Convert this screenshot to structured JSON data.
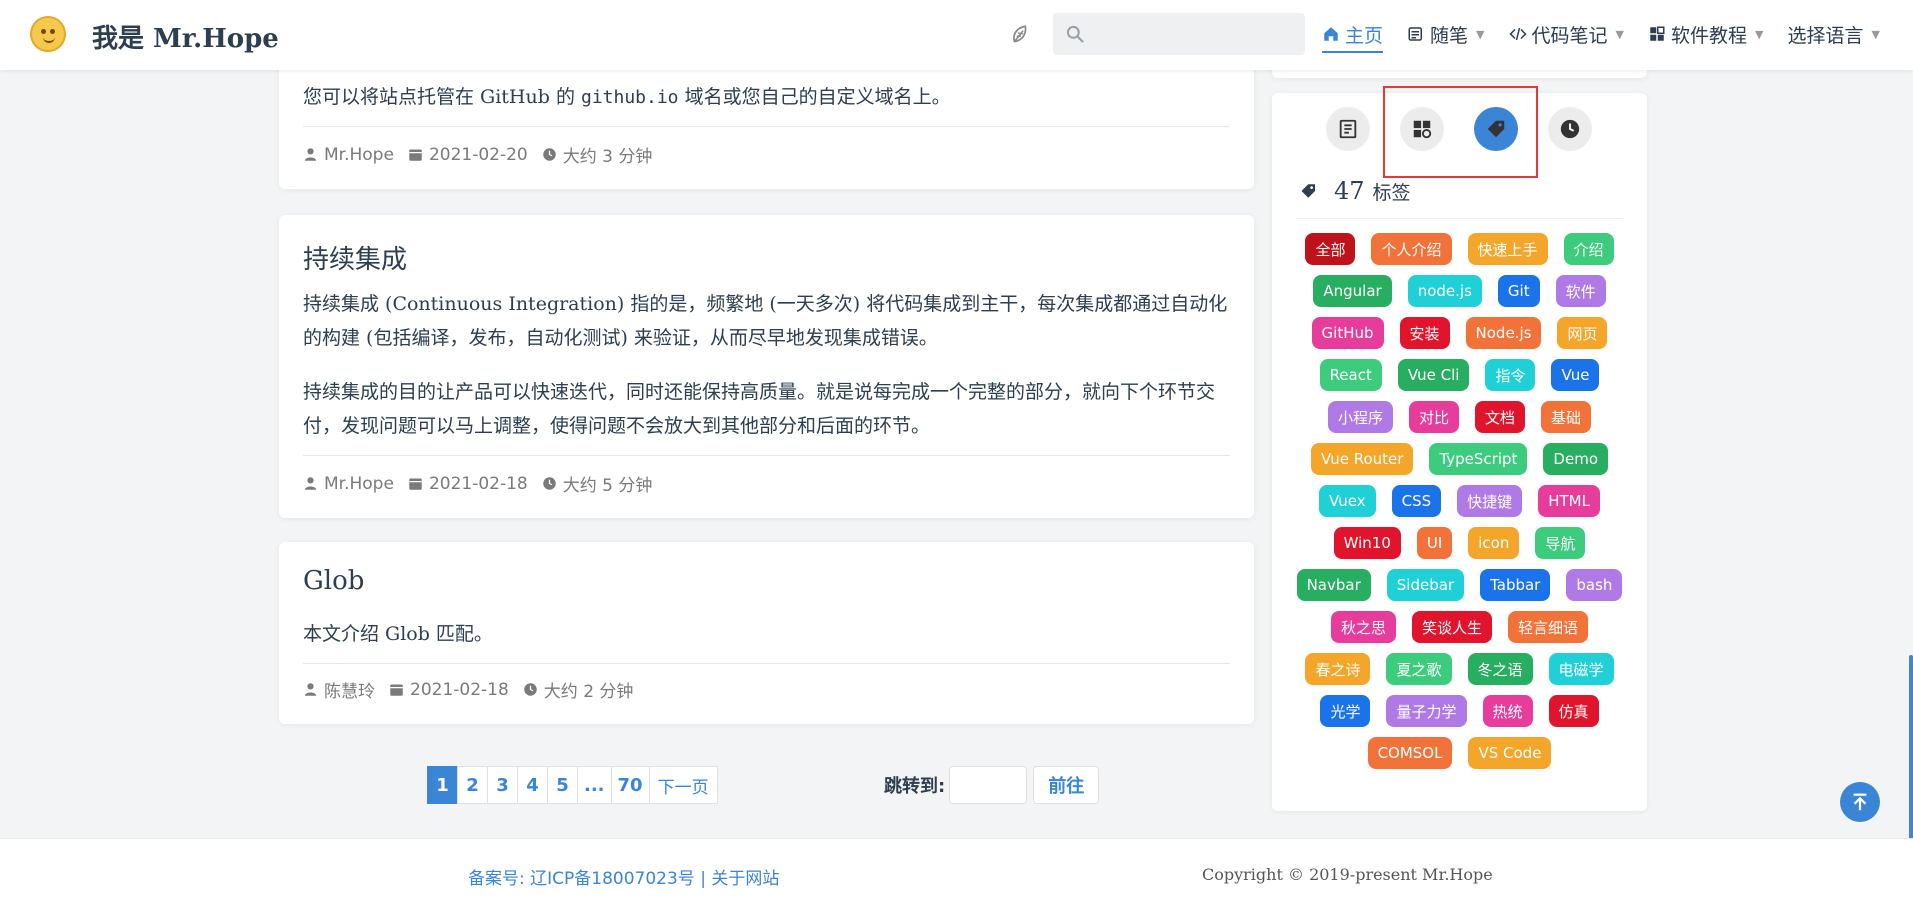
{
  "navbar": {
    "site_title": "我是 Mr.Hope",
    "search_placeholder": "",
    "items": [
      {
        "label": "主页",
        "icon": "home-icon",
        "active": true,
        "dropdown": false
      },
      {
        "label": "随笔",
        "icon": "notes-icon",
        "active": false,
        "dropdown": true
      },
      {
        "label": "代码笔记",
        "icon": "code-icon",
        "active": false,
        "dropdown": true
      },
      {
        "label": "软件教程",
        "icon": "app-icon",
        "active": false,
        "dropdown": true
      },
      {
        "label": "选择语言",
        "icon": "",
        "active": false,
        "dropdown": true
      }
    ]
  },
  "articles": [
    {
      "paragraph_pre": "您可以将站点托管在 GitHub 的 ",
      "paragraph_code": "github.io",
      "paragraph_post": " 域名或您自己的自定义域名上。",
      "author": "Mr.Hope",
      "date": "2021-02-20",
      "reading_time": "大约 3 分钟"
    },
    {
      "title": "持续集成",
      "paragraphs": [
        "持续集成 (Continuous Integration) 指的是，频繁地 (一天多次) 将代码集成到主干，每次集成都通过自动化的构建 (包括编译，发布，自动化测试) 来验证，从而尽早地发现集成错误。",
        "持续集成的目的让产品可以快速迭代，同时还能保持高质量。就是说每完成一个完整的部分，就向下个环节交付，发现问题可以马上调整，使得问题不会放大到其他部分和后面的环节。"
      ],
      "author": "Mr.Hope",
      "date": "2021-02-18",
      "reading_time": "大约 5 分钟"
    },
    {
      "title": "Glob",
      "paragraphs": [
        "本文介绍 Glob 匹配。"
      ],
      "author": "陈慧玲",
      "date": "2021-02-18",
      "reading_time": "大约 2 分钟"
    }
  ],
  "pagination": {
    "pages": [
      "1",
      "2",
      "3",
      "4",
      "5",
      "...",
      "70"
    ],
    "current": "1",
    "next_label": "下一页",
    "jump_label": "跳转到:",
    "jump_button": "前往"
  },
  "sidebar": {
    "tab_icons": [
      "article-icon",
      "category-icon",
      "tag-icon",
      "timeline-icon"
    ],
    "active_tab": "tag-icon",
    "tag_count": "47",
    "tag_label": "标签",
    "tags": [
      [
        {
          "label": "全部",
          "color": "#c0121b"
        },
        {
          "label": "个人介绍",
          "color": "#f2733a"
        },
        {
          "label": "快速上手",
          "color": "#f4a62a"
        },
        {
          "label": "介绍",
          "color": "#3dcc7e"
        }
      ],
      [
        {
          "label": "Angular",
          "color": "#27ae60"
        },
        {
          "label": "node.js",
          "color": "#1fd1d6"
        },
        {
          "label": "Git",
          "color": "#1a73e8"
        },
        {
          "label": "软件",
          "color": "#b07ae6"
        }
      ],
      [
        {
          "label": "GitHub",
          "color": "#e63c9c"
        },
        {
          "label": "安装",
          "color": "#e0152d"
        },
        {
          "label": "Node.js",
          "color": "#f2733a"
        },
        {
          "label": "网页",
          "color": "#f4a62a"
        }
      ],
      [
        {
          "label": "React",
          "color": "#3dcc7e"
        },
        {
          "label": "Vue Cli",
          "color": "#27ae60"
        },
        {
          "label": "指令",
          "color": "#1fd1d6"
        },
        {
          "label": "Vue",
          "color": "#1a73e8"
        }
      ],
      [
        {
          "label": "小程序",
          "color": "#b07ae6"
        },
        {
          "label": "对比",
          "color": "#e63c9c"
        },
        {
          "label": "文档",
          "color": "#e0152d"
        },
        {
          "label": "基础",
          "color": "#f2733a"
        }
      ],
      [
        {
          "label": "Vue Router",
          "color": "#f4a62a"
        },
        {
          "label": "TypeScript",
          "color": "#3dcc7e"
        },
        {
          "label": "Demo",
          "color": "#27ae60"
        }
      ],
      [
        {
          "label": "Vuex",
          "color": "#1fd1d6"
        },
        {
          "label": "CSS",
          "color": "#1a73e8"
        },
        {
          "label": "快捷键",
          "color": "#b07ae6"
        },
        {
          "label": "HTML",
          "color": "#e63c9c"
        }
      ],
      [
        {
          "label": "Win10",
          "color": "#e0152d"
        },
        {
          "label": "UI",
          "color": "#f2733a"
        },
        {
          "label": "icon",
          "color": "#f4a62a"
        },
        {
          "label": "导航",
          "color": "#3dcc7e"
        }
      ],
      [
        {
          "label": "Navbar",
          "color": "#27ae60"
        },
        {
          "label": "Sidebar",
          "color": "#1fd1d6"
        },
        {
          "label": "Tabbar",
          "color": "#1a73e8"
        },
        {
          "label": "bash",
          "color": "#b07ae6"
        }
      ],
      [
        {
          "label": "秋之思",
          "color": "#e63c9c"
        },
        {
          "label": "笑谈人生",
          "color": "#e0152d"
        },
        {
          "label": "轻言细语",
          "color": "#f2733a"
        }
      ],
      [
        {
          "label": "春之诗",
          "color": "#f4a62a"
        },
        {
          "label": "夏之歌",
          "color": "#3dcc7e"
        },
        {
          "label": "冬之语",
          "color": "#27ae60"
        },
        {
          "label": "电磁学",
          "color": "#1fd1d6"
        }
      ],
      [
        {
          "label": "光学",
          "color": "#1a73e8"
        },
        {
          "label": "量子力学",
          "color": "#b07ae6"
        },
        {
          "label": "热统",
          "color": "#e63c9c"
        },
        {
          "label": "仿真",
          "color": "#e0152d"
        }
      ],
      [
        {
          "label": "COMSOL",
          "color": "#f2733a"
        },
        {
          "label": "VS Code",
          "color": "#f4a62a"
        }
      ]
    ]
  },
  "footer": {
    "icp": "备案号: 辽ICP备18007023号",
    "separator": "|",
    "about": "关于网站",
    "copyright": "Copyright © 2019-present Mr.Hope"
  },
  "colors": {
    "accent": "#3a85d6",
    "highlight": "#e53935"
  }
}
